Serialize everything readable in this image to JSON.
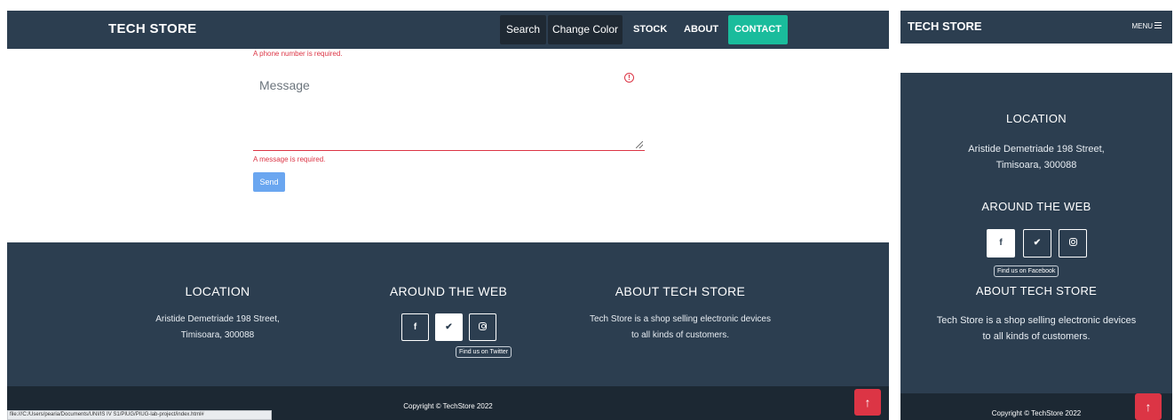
{
  "desktop": {
    "nav": {
      "brand": "TECH STORE",
      "search": "Search",
      "change_color": "Change Color",
      "stock": "STOCK",
      "about": "ABOUT",
      "contact": "CONTACT"
    },
    "form": {
      "phone_error": "A phone number is required.",
      "message_placeholder": "Message",
      "warning_glyph": "!",
      "message_error": "A message is required.",
      "send": "Send"
    },
    "footer": {
      "location_title": "LOCATION",
      "location_line1": "Aristide Demetriade 198 Street,",
      "location_line2": "Timisoara, 300088",
      "web_title": "AROUND THE WEB",
      "facebook_glyph": "f",
      "twitter_glyph": "✔",
      "tooltip": "Find us on Twitter",
      "about_title": "ABOUT TECH STORE",
      "about_line1": "Tech Store is a shop selling electronic devices",
      "about_line2": "to all kinds of customers."
    },
    "copyright": "Copyright © TechStore 2022",
    "up_glyph": "↑",
    "status_url": "file:///C:/Users/pearia/Documents/UNI/IS IV S1/PIUG/PIUG-lab-project/index.html#"
  },
  "mobile": {
    "brand": "TECH STORE",
    "menu": "MENU",
    "footer": {
      "location_title": "LOCATION",
      "location_line1": "Aristide Demetriade 198 Street,",
      "location_line2": "Timisoara, 300088",
      "web_title": "AROUND THE WEB",
      "facebook_glyph": "f",
      "twitter_glyph": "✔",
      "tooltip": "Find us on Facebook",
      "about_title": "ABOUT TECH STORE",
      "about_line1": "Tech Store is a shop selling electronic devices",
      "about_line2": "to all kinds of customers."
    },
    "copyright": "Copyright © TechStore 2022",
    "up_glyph": "↑"
  },
  "colors": {
    "navbar": "#2c3e50",
    "contact_accent": "#1abc9c",
    "error": "#dc3545",
    "send_button": "#6aa6f0",
    "copyright_bar": "#1c2833"
  }
}
